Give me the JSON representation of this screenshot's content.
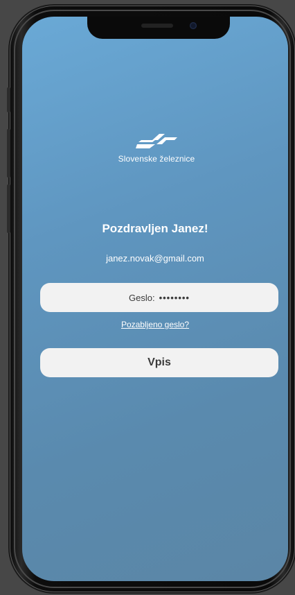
{
  "brand": {
    "logo_icon": "slovenske-zeleznice-logo",
    "name": "Slovenske železnice"
  },
  "login": {
    "greeting": "Pozdravljen Janez!",
    "email": "janez.novak@gmail.com",
    "password_label": "Geslo:",
    "password_mask": "••••••••",
    "forgot_link": "Pozabljeno geslo?",
    "submit_label": "Vpis"
  },
  "colors": {
    "background_gradient_top": "#6aa9d6",
    "background_gradient_bottom": "#5b86a6",
    "field_background": "#f2f2f2",
    "text_light": "#ffffff",
    "text_dark": "#3a3a3a"
  }
}
